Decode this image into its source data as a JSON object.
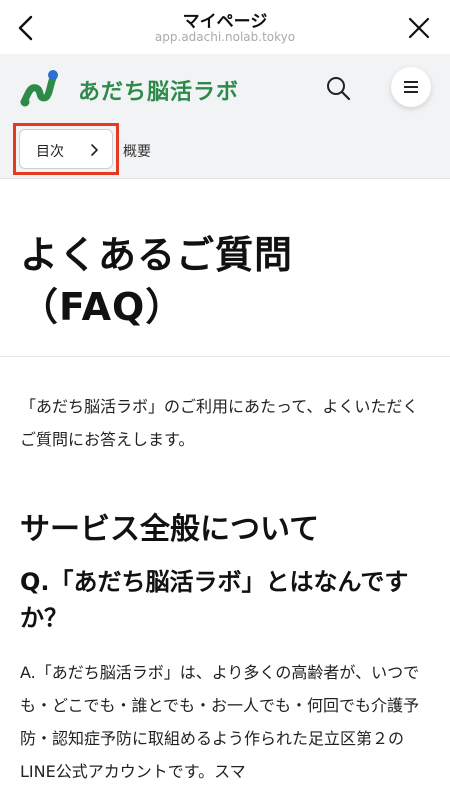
{
  "browser": {
    "title": "マイページ",
    "url": "app.adachi.nolab.tokyo"
  },
  "site": {
    "logo_text": "あだち脳活ラボ",
    "brand_color": "#2e8a4b"
  },
  "toc": {
    "button_label": "目次",
    "current_section": "概要",
    "highlight_color": "#e53a22"
  },
  "content": {
    "title_line1": "よくあるご質問",
    "title_line2": "（FAQ）",
    "intro": "「あだち脳活ラボ」のご利用にあたって、よくいただくご質問にお答えします。",
    "section_heading": "サービス全般について",
    "question": "Q.「あだち脳活ラボ」とはなんですか？",
    "answer": "A.「あだち脳活ラボ」は、より多くの高齢者が、いつでも・どこでも・誰とでも・お一人でも・何回でも介護予防・認知症予防に取組めるよう作られた足立区第２のLINE公式アカウントです。スマ"
  }
}
